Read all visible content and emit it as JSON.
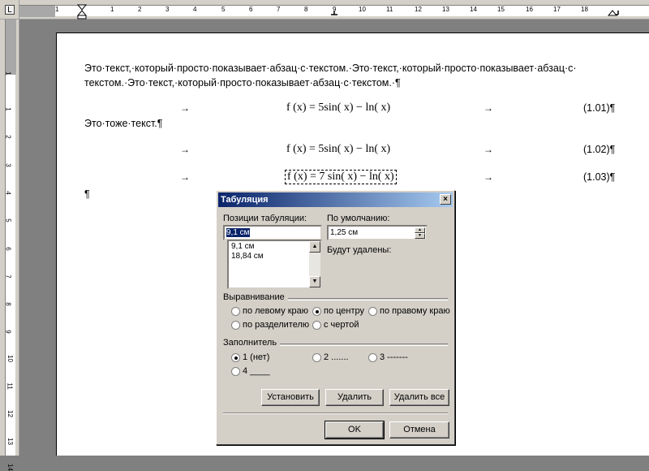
{
  "ruler": {
    "tab_selector": "L",
    "h_numbers": [
      "1",
      "1",
      "2",
      "3",
      "4",
      "5",
      "6",
      "7",
      "8",
      "9",
      "10",
      "11",
      "12",
      "13",
      "14",
      "15",
      "16",
      "17",
      "18"
    ],
    "v_numbers": [
      "1",
      "1",
      "2",
      "3",
      "4",
      "5",
      "6",
      "7",
      "8",
      "9",
      "10",
      "11",
      "12",
      "13",
      "14"
    ]
  },
  "document": {
    "para1_line1": "Это·текст,·который·просто·показывает·абзац·с·текстом.·Это·текст,·который·просто·показывает·абзац·с·",
    "para1_line2": "текстом.·Это·текст,·который·просто·показывает·абзац·с·текстом.·¶",
    "formula1": "f (x) = 5sin( x) − ln( x)",
    "number1": "(1.01)¶",
    "para2": "Это·тоже·текст.¶",
    "formula2": "f (x) = 5sin( x) − ln( x)",
    "number2": "(1.02)¶",
    "formula3": "f (x) = 7 sin( x) − ln( x)",
    "number3": "(1.03)¶",
    "empty_para": "¶",
    "tab_arrow": "→"
  },
  "dialog": {
    "title": "Табуляция",
    "close": "×",
    "tab_positions_label": "Позиции табуляции:",
    "tab_position_value": "9,1 см",
    "tab_positions_list": [
      "9,1 см",
      "18,84 см"
    ],
    "default_label": "По умолчанию:",
    "default_value": "1,25 см",
    "to_delete_label": "Будут удалены:",
    "alignment_label": "Выравнивание",
    "align_left": "по левому краю",
    "align_center": "по центру",
    "align_right": "по правому краю",
    "align_decimal": "по разделителю",
    "align_bar": "с чертой",
    "leader_label": "Заполнитель",
    "leader_1": "1 (нет)",
    "leader_2": "2 .......",
    "leader_3": "3 -------",
    "leader_4": "4 ____",
    "set_button": "Установить",
    "clear_button": "Удалить",
    "clear_all_button": "Удалить все",
    "ok_button": "OK",
    "cancel_button": "Отмена"
  }
}
